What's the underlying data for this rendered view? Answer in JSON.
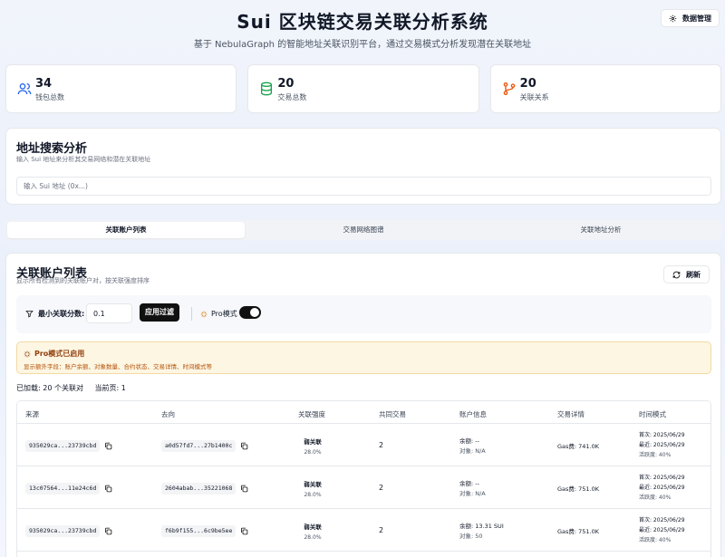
{
  "header": {
    "title": "Sui 区块链交易关联分析系统",
    "subtitle": "基于 NebulaGraph 的智能地址关联识别平台，通过交易模式分析发现潜在关联地址",
    "data_mgmt_label": "数据管理"
  },
  "stats": [
    {
      "icon": "users-icon",
      "value": "34",
      "label": "钱包总数",
      "color": "#2563eb"
    },
    {
      "icon": "database-icon",
      "value": "20",
      "label": "交易总数",
      "color": "#16a34a"
    },
    {
      "icon": "git-branch-icon",
      "value": "20",
      "label": "关联关系",
      "color": "#ea580c"
    }
  ],
  "search": {
    "title": "地址搜索分析",
    "description": "输入 Sui 地址来分析其交易网络和潜在关联地址",
    "placeholder": "输入 Sui 地址 (0x...)"
  },
  "tabs": [
    "关联账户列表",
    "交易网络图谱",
    "关联地址分析"
  ],
  "list": {
    "title": "关联账户列表",
    "description": "显示所有检测到的关联账户对，按关联强度排序",
    "refresh_label": "刷新",
    "filter": {
      "label": "最小关联分数:",
      "value": "0.1",
      "apply_label": "应用过滤",
      "pro_label": "Pro模式",
      "pro_enabled": true
    },
    "alert": {
      "title": "Pro模式已启用",
      "description": "显示额外字段：账户余额、对象数量、合约状态、交易详情、时间模式等"
    },
    "loaded_text": "已加载: 20 个关联对",
    "page_text": "当前页: 1",
    "columns": [
      "来源",
      "去向",
      "关联强度",
      "共同交易",
      "账户信息",
      "交易详情",
      "时间模式"
    ],
    "rows": [
      {
        "from": "935029ca...23739cbd",
        "to": "a0d57fd7...27b1400c",
        "strength": "弱关联",
        "score": "28.0%",
        "common": "2",
        "balance": "余额: --",
        "objects": "对象: N/A",
        "gas": "Gas费: 741.0K",
        "first": "首次: 2025/06/29",
        "last": "最近: 2025/06/29",
        "activity": "活跃度: 40%"
      },
      {
        "from": "13c07564...11e24c6d",
        "to": "2604abab...35221068",
        "strength": "弱关联",
        "score": "28.0%",
        "common": "2",
        "balance": "余额: --",
        "objects": "对象: N/A",
        "gas": "Gas费: 751.0K",
        "first": "首次: 2025/06/29",
        "last": "最近: 2025/06/29",
        "activity": "活跃度: 40%"
      },
      {
        "from": "935029ca...23739cbd",
        "to": "f6b9f155...6c9be5ee",
        "strength": "弱关联",
        "score": "28.0%",
        "common": "2",
        "balance": "余额: 13.31 SUI",
        "objects": "对象: 50",
        "gas": "Gas费: 751.0K",
        "first": "首次: 2025/06/29",
        "last": "最近: 2025/06/29",
        "activity": "活跃度: 40%"
      }
    ]
  }
}
